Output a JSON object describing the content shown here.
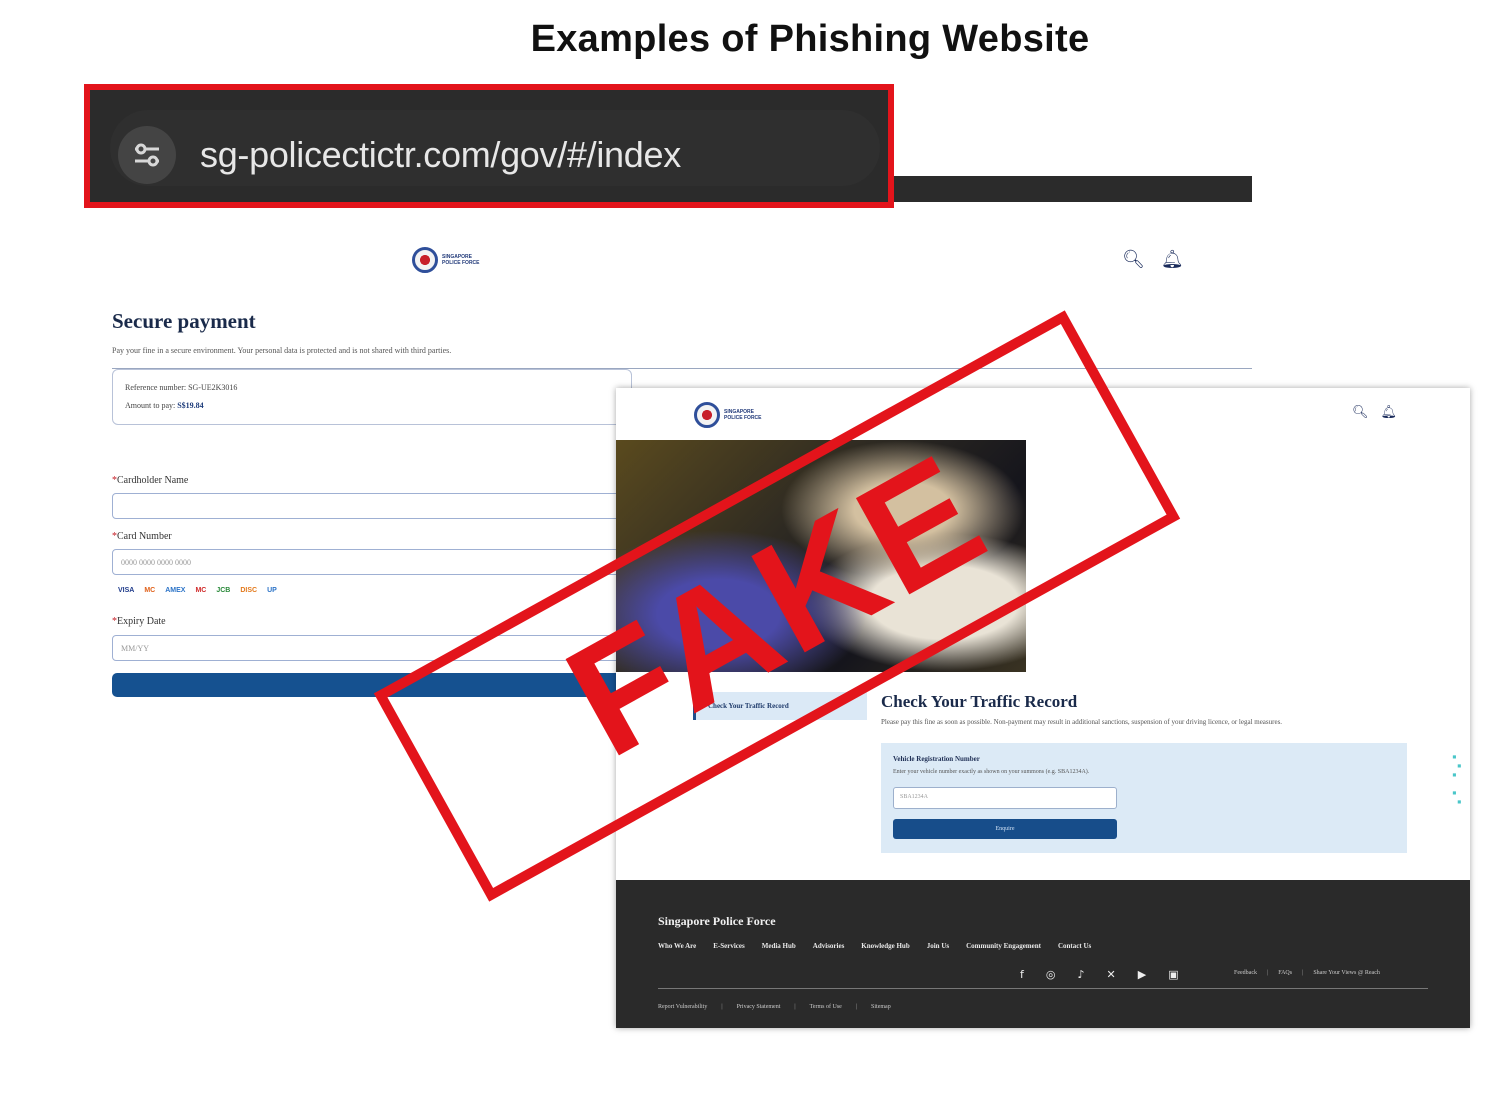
{
  "heading": "Examples of Phishing Website",
  "address_bar": {
    "url": "sg-policectictr.com/gov/#/index",
    "site_icon": "tune-settings-icon",
    "highlight_color": "#e3141b"
  },
  "logo": {
    "text_line1": "SINGAPORE",
    "text_line2": "POLICE FORCE"
  },
  "header_icons": [
    "search-icon",
    "bell-icon"
  ],
  "payment_page": {
    "title": "Secure payment",
    "subtitle": "Pay your fine in a secure environment. Your personal data is protected and is not shared with third parties.",
    "reference_label": "Reference number:",
    "reference_value": "SG-UE2K3016",
    "amount_label": "Amount to pay:",
    "amount_value": "S$19.84",
    "cardholder_label": "Cardholder Name",
    "card_number_label": "Card Number",
    "card_number_placeholder": "0000 0000 0000 0000",
    "expiry_label": "Expiry Date",
    "expiry_placeholder": "MM/YY",
    "card_logos": [
      "VISA",
      "MC",
      "AMEX",
      "MC",
      "JCB",
      "DISC",
      "UP"
    ]
  },
  "traffic_page": {
    "side_tab": "Check Your Traffic Record",
    "title": "Check Your Traffic Record",
    "subtitle": "Please pay this fine as soon as possible. Non-payment may result in additional sanctions, suspension of your driving licence, or legal measures.",
    "field_label": "Vehicle Registration Number",
    "field_help": "Enter your vehicle number exactly as shown on your summons (e.g. SBA1234A).",
    "field_placeholder": "SBA1234A",
    "button_label": "Enquire"
  },
  "footer": {
    "title": "Singapore Police Force",
    "nav": [
      "Who We Are",
      "E-Services",
      "Media Hub",
      "Advisories",
      "Knowledge Hub",
      "Join Us",
      "Community Engagement",
      "Contact Us"
    ],
    "social_icons": [
      "facebook-icon",
      "instagram-icon",
      "tiktok-icon",
      "x-icon",
      "youtube-icon",
      "linkedin-icon"
    ],
    "links": [
      "Feedback",
      "FAQs",
      "Share Your Views @ Reach"
    ],
    "bottom_links": [
      "Report Vulnerability",
      "Privacy Statement",
      "Terms of Use",
      "Sitemap"
    ]
  },
  "stamp_text": "FAKE"
}
